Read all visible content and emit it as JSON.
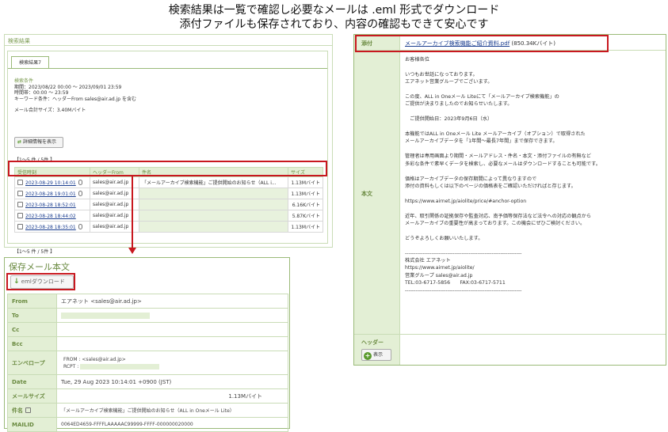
{
  "caption": {
    "line1": "検索結果は一覧で確認し必要なメールは .eml 形式でダウンロード",
    "line2": "添付ファイルも保存されており、内容の確認もできて安心です"
  },
  "search": {
    "header": "検索結果",
    "tab": "検索結果7",
    "cond_title": "検索条件",
    "cond_lines": [
      "期間：2023/08/22 00:00 ～ 2023/09/01 23:59",
      "時間帯：00:00 ～ 23:59",
      "キーワード条件：ヘッダーFrom sales@air.ad.jp を含む"
    ],
    "total_size": "メール合計サイズ：3.40Mバイト",
    "detail_btn": "詳細情報を表示",
    "count_top": "【1～5 件 / 5件 】",
    "count_bottom": "【1～5 件 / 5件 】",
    "columns": [
      "受信時刻",
      "ヘッダーFrom",
      "件名",
      "サイズ"
    ],
    "rows": [
      {
        "time": "2023-08-29 10:14:01",
        "from": "sales@air.ad.jp",
        "subject": "「メールアーカイブ検索機能」ご提供開始のお知らせ（ALL i...",
        "size": "1.13Mバイト"
      },
      {
        "time": "2023-08-28 19:01:01",
        "from": "sales@air.ad.jp",
        "subject": "",
        "size": "1.13Mバイト"
      },
      {
        "time": "2023-08-28 18:52:01",
        "from": "sales@air.ad.jp",
        "subject": "",
        "size": "6.16Kバイト"
      },
      {
        "time": "2023-08-28 18:44:02",
        "from": "sales@air.ad.jp",
        "subject": "",
        "size": "5.87Kバイト"
      },
      {
        "time": "2023-08-28 18:35:01",
        "from": "sales@air.ad.jp",
        "subject": "",
        "size": "1.13Mバイト"
      }
    ]
  },
  "saved": {
    "title": "保存メール本文",
    "eml_btn": "emlダウンロード",
    "labels": {
      "from": "From",
      "to": "To",
      "cc": "Cc",
      "bcc": "Bcc",
      "envelope": "エンベロープ",
      "date": "Date",
      "size": "メールサイズ",
      "subject": "件名",
      "mailid": "MAILID"
    },
    "from": "エアネット <sales@air.ad.jp>",
    "envelope_from": "FROM : <sales@air.ad.jp>",
    "envelope_rcpt": "RCPT :",
    "date": "Tue, 29 Aug 2023 10:14:01 +0900 (JST)",
    "size": "1.13Mバイト",
    "subject": "「メールアーカイブ検索機能」ご提供開始のお知らせ（ALL in Oneメール Lite）",
    "mailid": "0064ED4659-FFFFLAAAAAC99999-FFFF-000000020000"
  },
  "detail": {
    "attach_label": "添付",
    "attach_file": "メールアーカイブ検索機能ご紹介資料.pdf",
    "attach_size": "(850.34Kバイト)",
    "body_label": "本文",
    "body_text": "お客様各位\n\nいつもお世話になっております。\nエアネット営業グループでございます。\n\nこの度、ALL in Oneメール Liteにて「メールアーカイブ検索機能」の\nご提供が決まりましたのでお知らせいたします。\n\n　ご提供開始日：2023年9月6日（水）\n\n本機能ではALL in Oneメール Lite メールアーカイブ（オプション）で取得された\nメールアーカイブデータを「1年間～最長7年間」まで保存できます。\n\n管理者は専用画面より期間・メールアドレス・件名・本文・添付ファイルの有無など\n多彩な条件で素早くデータを検索し、必要なメールはダウンロードすることも可能です。\n\n価格はアーカイブデータの保存期間によって異なりますので\n添付の資料もしくは以下のページの価格表をご確認いただければと存じます。\n\nhttps://www.airnet.jp/aiolite/price/#anchor-option\n\n近年、取引関係の証拠保存や監査対応、南予価等保存法など法令への対応の観点から\nメールアーカイブの重要性が高まっております。この機会にぜひご検討ください。\n\nどうぞよろしくお願いいたします。\n\n------------------------------------------------------------------\n株式会社 エアネット\nhttps://www.airnet.jp/aiolite/\n営業グループ sales@air.ad.jp\nTEL:03-6717-5856　　FAX:03-6717-5711\n------------------------------------------------------------------",
    "header_label": "ヘッダー",
    "show_btn": "表示"
  }
}
